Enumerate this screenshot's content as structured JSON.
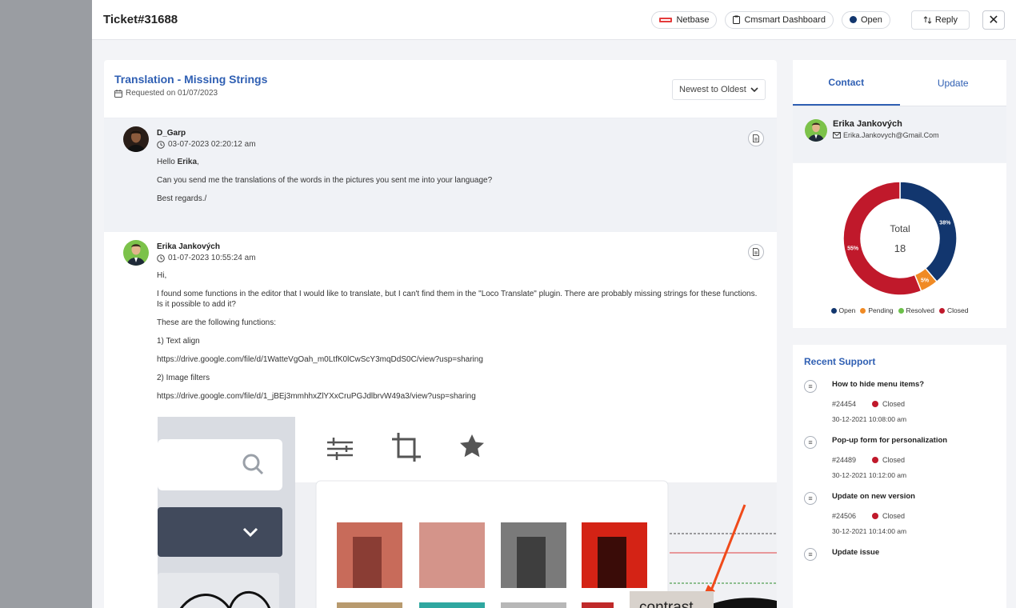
{
  "header": {
    "ticket_title": "Ticket#31688",
    "badges": [
      {
        "label": "Netbase",
        "icon": "netbase-logo-icon"
      },
      {
        "label": "Cmsmart Dashboard",
        "icon": "clipboard-icon"
      },
      {
        "label": "Open",
        "icon": "status-dot-icon",
        "color": "#12366e"
      }
    ],
    "reply_label": "Reply",
    "close_glyph": "✕"
  },
  "ticket": {
    "subject": "Translation - Missing Strings",
    "requested_on": "Requested on 01/07/2023",
    "sort_value": "Newest to Oldest"
  },
  "messages": [
    {
      "author": "D_Garp",
      "timestamp": "03-07-2023 02:20:12 am",
      "greeting_prefix": "Hello ",
      "greeting_name": "Erika",
      "greeting_suffix": ",",
      "lines": [
        "Can you send me the translations of the words in the pictures you sent me into your language?",
        "Best regards./"
      ]
    },
    {
      "author": "Erika Jankových",
      "timestamp": "01-07-2023 10:55:24 am",
      "lines": [
        "Hi,",
        "I found some functions in the editor that I would like to translate, but I can't find them in the \"Loco Translate\" plugin. There are probably missing strings for these functions. Is it possible to add it?",
        "These are the following functions:",
        "1) Text align",
        "https://drive.google.com/file/d/1WatteVgOah_m0LtfK0lCwScY3mqDdS0C/view?usp=sharing",
        "2) Image filters",
        "https://drive.google.com/file/d/1_jBEj3mmhhxZlYXxCruPGJdlbrvW49a3/view?usp=sharing"
      ],
      "attachment_caption": "contrast"
    }
  ],
  "sidebar": {
    "tabs": [
      {
        "label": "Contact",
        "active": true
      },
      {
        "label": "Update",
        "active": false
      }
    ],
    "contact": {
      "name": "Erika Jankových",
      "email": "Erika.Jankovych@Gmail.Com"
    },
    "stats": {
      "total_label": "Total",
      "total_value": "18",
      "legend": [
        {
          "label": "Open",
          "color": "#12366e"
        },
        {
          "label": "Pending",
          "color": "#f08a24"
        },
        {
          "label": "Resolved",
          "color": "#6cc04a"
        },
        {
          "label": "Closed",
          "color": "#c0192b"
        }
      ]
    },
    "recent": {
      "title": "Recent Support",
      "items": [
        {
          "title": "How to hide menu items?",
          "id": "#24454",
          "status": "Closed",
          "date": "30-12-2021 10:08:00 am"
        },
        {
          "title": "Pop-up form for personalization",
          "id": "#24489",
          "status": "Closed",
          "date": "30-12-2021 10:12:00 am"
        },
        {
          "title": "Update on new version",
          "id": "#24506",
          "status": "Closed",
          "date": "30-12-2021 10:14:00 am"
        },
        {
          "title": "Update issue",
          "id": "",
          "status": "",
          "date": ""
        }
      ]
    }
  },
  "chart_data": {
    "type": "pie",
    "categories": [
      "Open",
      "Pending",
      "Resolved",
      "Closed"
    ],
    "values": [
      38,
      5,
      0,
      55
    ],
    "value_labels": [
      "38%",
      "5%",
      "",
      "55%"
    ],
    "colors": [
      "#12366e",
      "#f08a24",
      "#6cc04a",
      "#c0192b"
    ],
    "total": 18,
    "legend_position": "bottom"
  }
}
